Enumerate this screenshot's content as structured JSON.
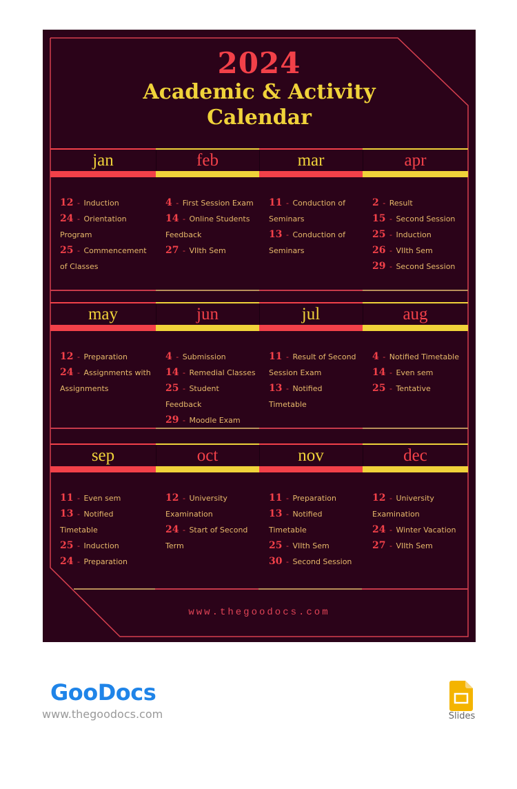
{
  "header": {
    "year": "2024",
    "title": "Academic & Activity Calendar"
  },
  "colors": {
    "background": "#2b0319",
    "red": "#f24149",
    "yellow": "#f0d33a",
    "text": "#e7b96a"
  },
  "months": [
    {
      "label": "jan",
      "events": [
        {
          "day": "12",
          "text": "Induction"
        },
        {
          "day": "24",
          "text": "Orientation Program"
        },
        {
          "day": "25",
          "text": "Commencement of Classes"
        }
      ]
    },
    {
      "label": "feb",
      "events": [
        {
          "day": "4",
          "text": "First Session Exam"
        },
        {
          "day": "14",
          "text": "Online Students Feedback"
        },
        {
          "day": "27",
          "text": "VIIth Sem"
        }
      ]
    },
    {
      "label": "mar",
      "events": [
        {
          "day": "11",
          "text": "Conduction of Seminars"
        },
        {
          "day": "13",
          "text": "Conduction of Seminars"
        }
      ]
    },
    {
      "label": "apr",
      "events": [
        {
          "day": "2",
          "text": "Result"
        },
        {
          "day": "15",
          "text": "Second Session"
        },
        {
          "day": "25",
          "text": "Induction"
        },
        {
          "day": "26",
          "text": "VIIth Sem"
        },
        {
          "day": "29",
          "text": "Second Session"
        }
      ]
    },
    {
      "label": "may",
      "events": [
        {
          "day": "12",
          "text": "Preparation"
        },
        {
          "day": "24",
          "text": "Assignments with Assignments"
        }
      ]
    },
    {
      "label": "jun",
      "events": [
        {
          "day": "4",
          "text": "Submission"
        },
        {
          "day": "14",
          "text": "Remedial Classes"
        },
        {
          "day": "25",
          "text": "Student Feedback"
        },
        {
          "day": "29",
          "text": "Moodle Exam"
        }
      ]
    },
    {
      "label": "jul",
      "events": [
        {
          "day": "11",
          "text": "Result of Second Session Exam"
        },
        {
          "day": "13",
          "text": "Notified Timetable"
        }
      ]
    },
    {
      "label": "aug",
      "events": [
        {
          "day": "4",
          "text": "Notified Timetable"
        },
        {
          "day": "14",
          "text": "Even sem"
        },
        {
          "day": "25",
          "text": "Tentative"
        }
      ]
    },
    {
      "label": "sep",
      "events": [
        {
          "day": "11",
          "text": "Even sem"
        },
        {
          "day": "13",
          "text": "Notified Timetable"
        },
        {
          "day": "25",
          "text": "Induction"
        },
        {
          "day": "24",
          "text": "Preparation"
        }
      ]
    },
    {
      "label": "oct",
      "events": [
        {
          "day": "12",
          "text": "University Examination"
        },
        {
          "day": "24",
          "text": "Start of Second Term"
        }
      ]
    },
    {
      "label": "nov",
      "events": [
        {
          "day": "11",
          "text": "Preparation"
        },
        {
          "day": "13",
          "text": "Notified Timetable"
        },
        {
          "day": "25",
          "text": "VIIth Sem"
        },
        {
          "day": "30",
          "text": "Second Session"
        }
      ]
    },
    {
      "label": "dec",
      "events": [
        {
          "day": "12",
          "text": "University Examination"
        },
        {
          "day": "24",
          "text": "Winter Vacation"
        },
        {
          "day": "27",
          "text": "VIIth Sem"
        }
      ]
    }
  ],
  "footer": {
    "url": "www.thegoodocs.com"
  },
  "branding": {
    "logo_text": "GooDocs",
    "logo_url": "www.thegoodocs.com",
    "app_label": "Slides",
    "app_icon": "google-slides-icon"
  }
}
